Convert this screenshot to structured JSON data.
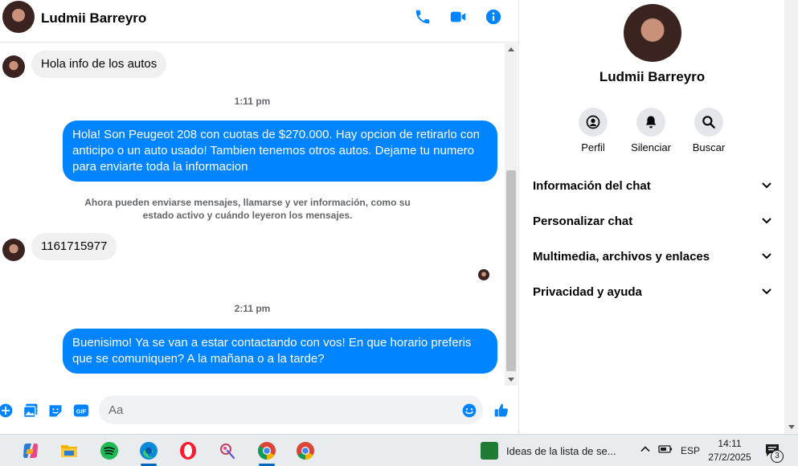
{
  "header": {
    "contact_name": "Ludmii Barreyro",
    "icons": [
      "phone-icon",
      "video-camera-icon",
      "info-icon"
    ]
  },
  "messages": [
    {
      "type": "in",
      "text": "Hola info de los autos"
    },
    {
      "type": "time",
      "text": "1:11 pm"
    },
    {
      "type": "out",
      "text": "Hola! Son Peugeot 208 con cuotas de $270.000. Hay opcion de retirarlo con anticipo o un auto usado! Tambien tenemos otros autos. Dejame tu numero para enviarte toda la informacion"
    },
    {
      "type": "system",
      "text": "Ahora pueden enviarse mensajes, llamarse y ver información, como su estado activo y cuándo leyeron los mensajes."
    },
    {
      "type": "in",
      "text": "1161715977"
    },
    {
      "type": "time",
      "text": "2:11 pm"
    },
    {
      "type": "out",
      "text": "Buenisimo! Ya se van a estar contactando con vos! En que horario preferis que se comuniquen? A la mañana o a la tarde?"
    }
  ],
  "composer": {
    "placeholder": "Aa",
    "icons": [
      "plus-icon",
      "gallery-icon",
      "sticker-icon",
      "gif-icon",
      "emoji-icon",
      "thumbs-up-icon"
    ],
    "gif_label": "GIF"
  },
  "info_panel": {
    "name": "Ludmii Barreyro",
    "actions": [
      {
        "label": "Perfil",
        "icon": "profile-icon"
      },
      {
        "label": "Silenciar",
        "icon": "bell-icon"
      },
      {
        "label": "Buscar",
        "icon": "search-icon"
      }
    ],
    "sections": [
      "Información del chat",
      "Personalizar chat",
      "Multimedia, archivos y enlaces",
      "Privacidad y ayuda"
    ]
  },
  "taskbar": {
    "apps": [
      "copilot-icon",
      "file-explorer-icon",
      "spotify-icon",
      "edge-icon",
      "opera-icon",
      "paint-icon",
      "chrome-icon",
      "chrome-profile-icon"
    ],
    "widget_text": "Ideas de la lista de se...",
    "language": "ESP",
    "time": "14:11",
    "date": "27/2/2025",
    "notification_count": "3"
  },
  "colors": {
    "accent": "#0084ff",
    "bubble_in": "#f0f0f0",
    "text_secondary": "#65676b"
  }
}
